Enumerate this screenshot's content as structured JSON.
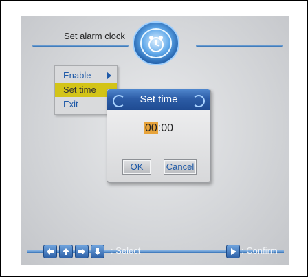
{
  "header": {
    "title": "Set alarm clock",
    "icon": "alarm-clock-icon"
  },
  "menu": {
    "items": [
      {
        "label": "Enable",
        "selected": false,
        "has_submenu": true
      },
      {
        "label": "Set time",
        "selected": true,
        "has_submenu": false
      },
      {
        "label": "Exit",
        "selected": false,
        "has_submenu": false
      }
    ]
  },
  "dialog": {
    "title": "Set time",
    "hours": "00",
    "separator": ":",
    "minutes": "00",
    "ok_label": "OK",
    "cancel_label": "Cancel"
  },
  "footer": {
    "select_label": ": Select",
    "confirm_label": ": Confirm",
    "nav_icons": [
      "arrow-left-icon",
      "arrow-up-icon",
      "arrow-right-icon",
      "arrow-down-icon"
    ],
    "confirm_icon": "play-icon"
  },
  "colors": {
    "accent_blue": "#2c5ca6",
    "selection_yellow": "#d3c418",
    "edit_highlight": "#e7a33a"
  }
}
